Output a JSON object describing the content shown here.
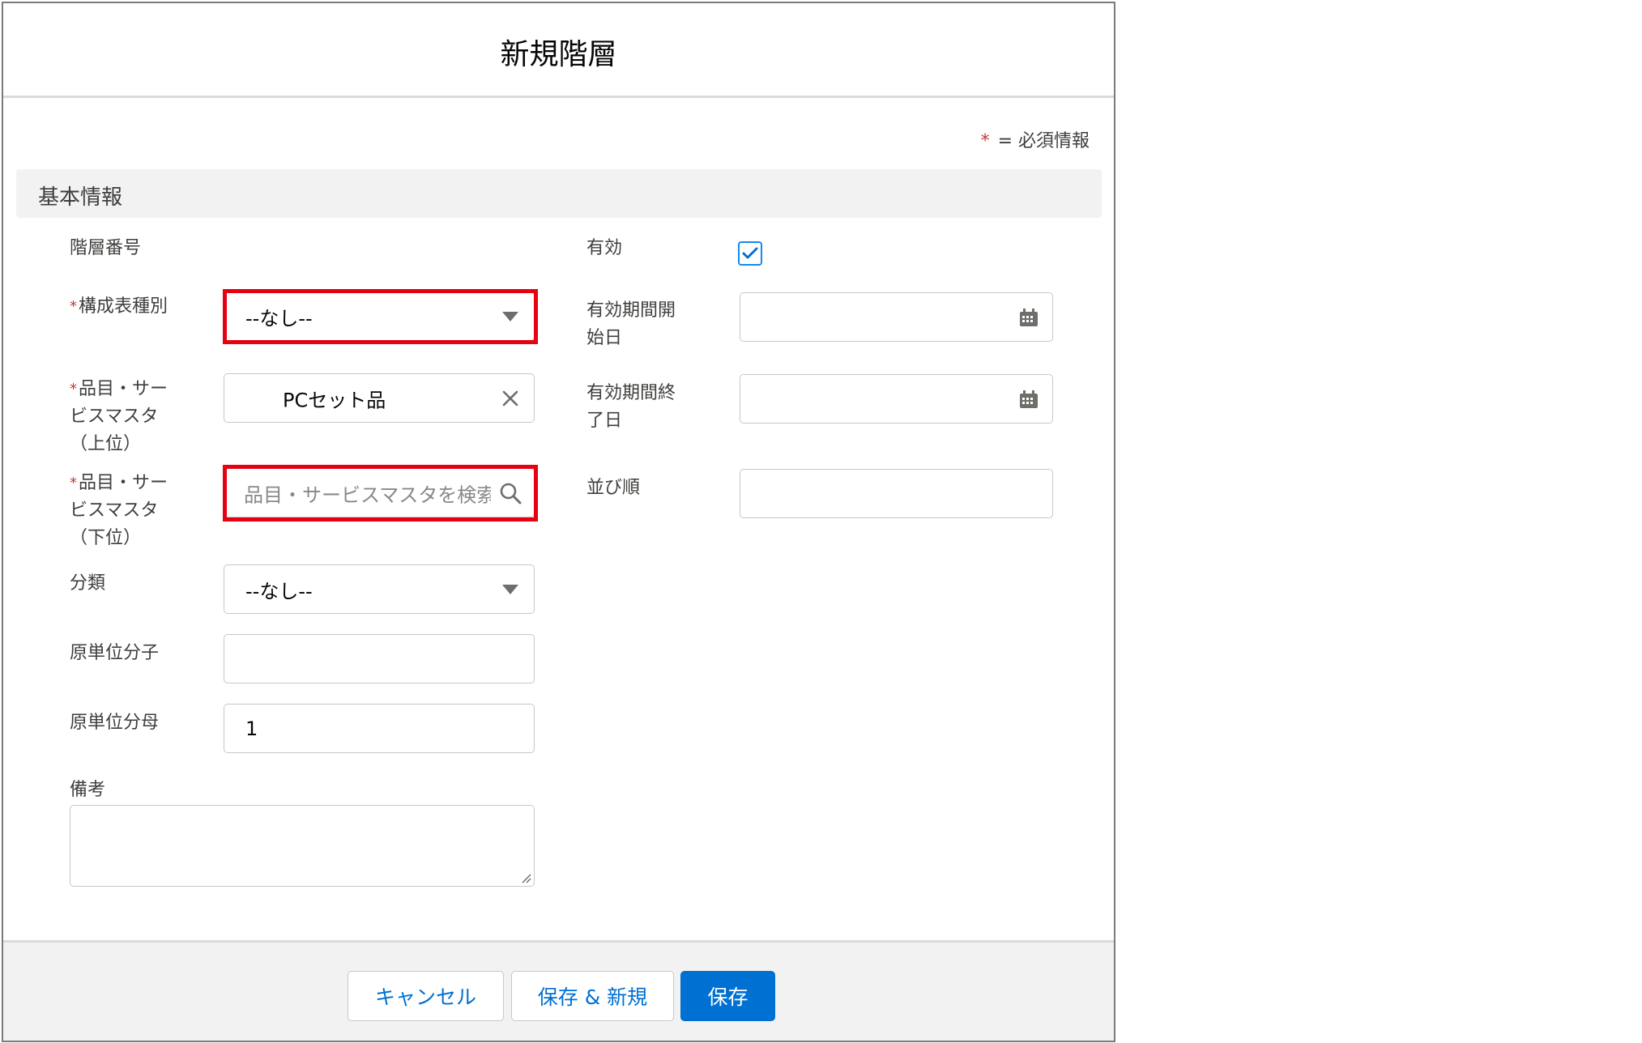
{
  "modal": {
    "title": "新規階層",
    "required_legend_star": "*",
    "required_legend_text": "= 必須情報"
  },
  "section": {
    "title": "基本情報"
  },
  "left_fields": {
    "hierarchy_number_label": "階層番号",
    "bom_type_label": "構成表種別",
    "bom_type_value": "--なし--",
    "parent_item_label_1": "品目・サー",
    "parent_item_label_2": "ビスマスタ",
    "parent_item_label_3": "（上位）",
    "parent_item_value": "PCセット品",
    "child_item_label_1": "品目・サー",
    "child_item_label_2": "ビスマスタ",
    "child_item_label_3": "（下位）",
    "child_item_placeholder": "品目・サービスマスタを検索...",
    "category_label": "分類",
    "category_value": "--なし--",
    "unit_numerator_label": "原単位分子",
    "unit_numerator_value": "",
    "unit_denominator_label": "原単位分母",
    "unit_denominator_value": "1",
    "remarks_label": "備考",
    "required_mark": "*"
  },
  "right_fields": {
    "active_label": "有効",
    "active_checked": true,
    "start_date_label_1": "有効期間開",
    "start_date_label_2": "始日",
    "start_date_value": "",
    "end_date_label_1": "有効期間終",
    "end_date_label_2": "了日",
    "end_date_value": "",
    "sort_order_label": "並び順",
    "sort_order_value": ""
  },
  "footer": {
    "cancel_label": "キャンセル",
    "save_new_label": "保存 & 新規",
    "save_label": "保存"
  },
  "icons": {
    "dropdown": "chevron-down-icon",
    "clear": "close-icon",
    "search": "search-icon",
    "calendar": "calendar-icon",
    "check": "check-icon"
  },
  "colors": {
    "brand": "#0070d2",
    "required": "#c23934",
    "highlight": "#e60012",
    "section_bg": "#f3f2f2"
  }
}
